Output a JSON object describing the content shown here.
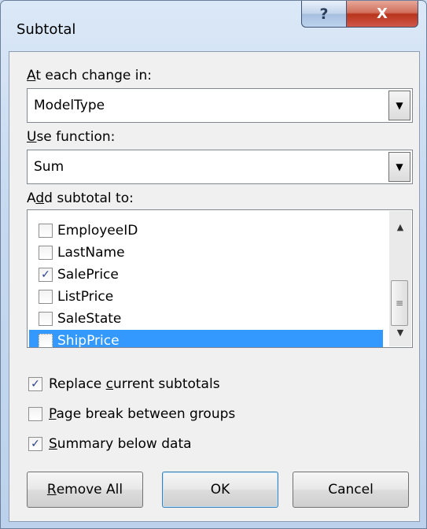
{
  "window": {
    "title": "Subtotal",
    "help_glyph": "?",
    "close_glyph": "X"
  },
  "group_by": {
    "label_underlined": "A",
    "label_rest": "t each change in:",
    "selected": "ModelType"
  },
  "function": {
    "label_underlined": "U",
    "label_rest": "se function:",
    "selected": "Sum"
  },
  "add_subtotal": {
    "label_pre": "A",
    "label_underlined": "d",
    "label_rest": "d subtotal to:",
    "items": [
      {
        "label": "EmployeeID",
        "checked": false,
        "mark": ""
      },
      {
        "label": "LastName",
        "checked": false,
        "mark": ""
      },
      {
        "label": "SalePrice",
        "checked": true,
        "mark": "✓"
      },
      {
        "label": "ListPrice",
        "checked": false,
        "mark": ""
      },
      {
        "label": "SaleState",
        "checked": false,
        "mark": ""
      },
      {
        "label": "ShipPrice",
        "checked": false,
        "mark": "",
        "selected": true
      }
    ]
  },
  "options": {
    "replace": {
      "pre": "Replace ",
      "underlined": "c",
      "rest": "urrent subtotals",
      "checked": true,
      "mark": "✓"
    },
    "page_break": {
      "pre": "",
      "underlined": "P",
      "rest": "age break between groups",
      "checked": false,
      "mark": ""
    },
    "summary": {
      "pre": "",
      "underlined": "S",
      "rest": "ummary below data",
      "checked": true,
      "mark": "✓"
    }
  },
  "buttons": {
    "remove_underlined": "R",
    "remove_rest": "emove All",
    "ok": "OK",
    "cancel": "Cancel"
  },
  "icons": {
    "dropdown": "▼",
    "scroll_up": "▲",
    "scroll_down": "▼",
    "thumb_grip": "≡"
  }
}
